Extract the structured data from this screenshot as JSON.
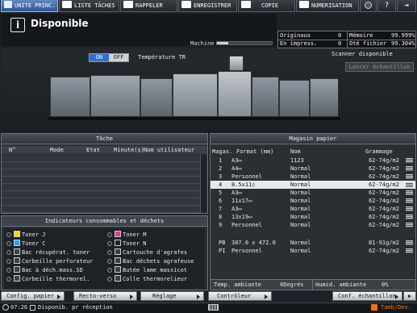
{
  "tabs": [
    {
      "label": "UNITE PRINC."
    },
    {
      "label": "LISTE TÂCHES"
    },
    {
      "label": "RAPPELER"
    },
    {
      "label": "ENREGISTRER"
    },
    {
      "label": "COPIE"
    },
    {
      "label": "NUMERISATION"
    }
  ],
  "status": {
    "title": "Disponible",
    "machine_label": "Machine",
    "counters": [
      {
        "label": "Originaux",
        "value": "0",
        "label2": "Mémoire",
        "value2": "99.999%"
      },
      {
        "label": "En impress.",
        "value": "0",
        "label2": "Oté fichier",
        "value2": "99.304%"
      }
    ],
    "scanner_status": "Scanner disponible",
    "sample_button": "Lancer échantillon"
  },
  "temperature": {
    "on_label": "ON",
    "off_label": "OFF",
    "label": "Température TR"
  },
  "task": {
    "title": "Tâche",
    "columns": [
      "N°",
      "Mode",
      "Etat",
      "Minute(s)",
      "Nom utilisateur"
    ]
  },
  "consumables": {
    "title": "Indicateurs consommables et déchets",
    "items_left": [
      "Toner J",
      "Toner C",
      "Bac récupérat. toner",
      "Corbeille perforateur",
      "Bac à déch.mass.SD",
      "Corbeille thermorel."
    ],
    "items_right": [
      "Toner M",
      "Toner N",
      "Cartouche d'agrafes",
      "Bac déchets agrafeuse",
      "Butée lame massicot",
      "Colle thermorelieur"
    ],
    "colors_left": [
      "#f2d21a",
      "#23a6e0",
      null,
      null,
      null,
      null
    ],
    "colors_right": [
      "#e03b9a",
      "#222222",
      null,
      null,
      null,
      null
    ]
  },
  "paper": {
    "title": "Magasin papier",
    "columns": [
      "Magas.",
      "Format (mm)",
      "Nom",
      "Grammage"
    ],
    "rows": [
      {
        "tray": "1",
        "format": "A3▭",
        "name": "1123",
        "weight": "62-74g/m2",
        "selected": false
      },
      {
        "tray": "2",
        "format": "A4▭",
        "name": "Normal",
        "weight": "62-74g/m2",
        "selected": false
      },
      {
        "tray": "3",
        "format": "Personnel",
        "name": "Normal",
        "weight": "62-74g/m2",
        "selected": false
      },
      {
        "tray": "4",
        "format": "8.5x11▯",
        "name": "Normal",
        "weight": "62-74g/m2",
        "selected": true
      },
      {
        "tray": "5",
        "format": "A3▭",
        "name": "Normal",
        "weight": "62-74g/m2",
        "selected": false
      },
      {
        "tray": "6",
        "format": "11x17▭",
        "name": "Normal",
        "weight": "62-74g/m2",
        "selected": false
      },
      {
        "tray": "7",
        "format": "A3▭",
        "name": "Normal",
        "weight": "62-74g/m2",
        "selected": false
      },
      {
        "tray": "8",
        "format": "13x19▭",
        "name": "Normal",
        "weight": "62-74g/m2",
        "selected": false
      },
      {
        "tray": "9",
        "format": "Personnel",
        "name": "Normal",
        "weight": "62-74g/m2",
        "selected": false
      }
    ],
    "extra_rows": [
      {
        "tray": "PB",
        "format": "307.0 x 472.0",
        "name": "Normal",
        "weight": "81-91g/m2",
        "selected": false
      },
      {
        "tray": "PI",
        "format": "Personnel",
        "name": "Normal",
        "weight": "62-74g/m2",
        "selected": false
      }
    ],
    "temp_label": "Temp. ambiante",
    "temp_value": "0Degrés",
    "humid_label": "Humid. ambiante",
    "humid_value": "0%"
  },
  "bottom_buttons": [
    "Config. papier",
    "Recto-verso",
    "Réglage",
    "Contrôleur",
    "Conf. échantillon"
  ],
  "footer": {
    "time": "07:26",
    "status": "Disponib. pr réception",
    "badge": "Tamb/Dev."
  }
}
